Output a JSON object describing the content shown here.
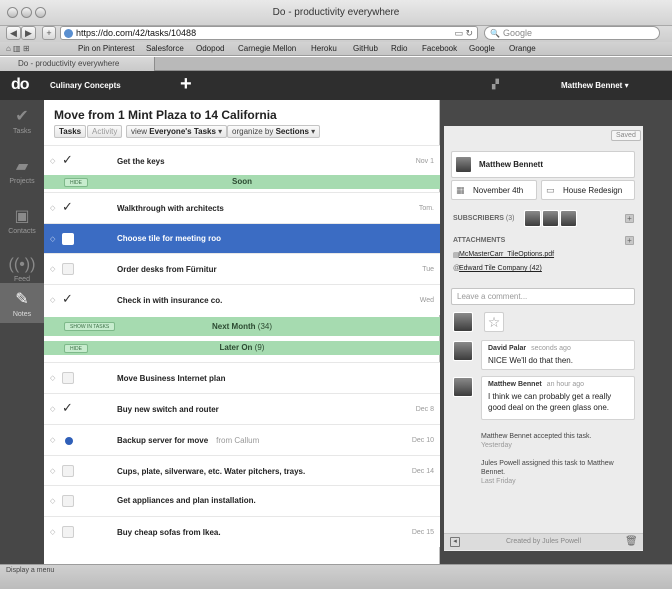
{
  "window": {
    "title": "Do - productivity everywhere"
  },
  "browser": {
    "url": "https://do.com/42/tasks/10488",
    "search_placeholder": "Google",
    "tab_title": "Do - productivity everywhere",
    "bookmarks": [
      "Pin on Pinterest",
      "Salesforce",
      "Odopod",
      "Carnegie Mellon",
      "Heroku",
      "GitHub",
      "Rdio",
      "Facebook",
      "Google",
      "Orange"
    ],
    "status": "Display a menu"
  },
  "app": {
    "logo": "do",
    "workspace": "Culinary Concepts",
    "user": "Matthew Bennet"
  },
  "nav": [
    {
      "label": "Tasks",
      "icon": "check-icon"
    },
    {
      "label": "Projects",
      "icon": "folder-icon"
    },
    {
      "label": "Contacts",
      "icon": "contact-card-icon"
    },
    {
      "label": "Feed",
      "icon": "broadcast-icon"
    },
    {
      "label": "Notes",
      "icon": "pencil-icon"
    }
  ],
  "project": {
    "title": "Move from 1 Mint Plaza to 14 California",
    "tabs": [
      "Tasks",
      "Activity"
    ],
    "view_prefix": "view",
    "view_value": "Everyone's Tasks",
    "organize_prefix": "organize by",
    "organize_value": "Sections"
  },
  "tasks_top": [
    {
      "text": "Get the keys",
      "date": "Nov 1",
      "checked": true
    },
    {
      "text": "Walkthrough with architects",
      "date": "Tom.",
      "checked": true
    },
    {
      "text": "Choose tile for meeting roo",
      "date": "",
      "checked": false,
      "selected": true
    },
    {
      "text": "Order desks from Fürnitur",
      "date": "Tue",
      "checked": false
    },
    {
      "text": "Check in with insurance co.",
      "date": "Wed",
      "checked": true
    }
  ],
  "sections": {
    "soon": {
      "tag": "HIDE",
      "title": "Soon"
    },
    "next_month": {
      "tag": "SHOW IN TASKS",
      "title": "Next Month",
      "count": "(34)"
    },
    "later_on": {
      "tag": "HIDE",
      "title": "Later On",
      "count": "(9)"
    }
  },
  "tasks_later": [
    {
      "text": "Move Business Internet plan",
      "sub": "",
      "date": "",
      "state": "open"
    },
    {
      "text": "Buy new switch and router",
      "sub": "",
      "date": "Dec 8",
      "state": "checked"
    },
    {
      "text": "Backup server for move",
      "sub": "from Callum",
      "date": "Dec 10",
      "state": "dot"
    },
    {
      "text": "Cups, plate, silverware, etc. Water pitchers, trays.",
      "sub": "",
      "date": "Dec 14",
      "state": "open"
    },
    {
      "text": "Get appliances and plan installation.",
      "sub": "",
      "date": "",
      "state": "open"
    },
    {
      "text": "Buy cheap sofas from Ikea.",
      "sub": "",
      "date": "Dec 15",
      "state": "open"
    }
  ],
  "detail": {
    "saved": "Saved",
    "assignee": "Matthew Bennett",
    "due": "November 4th",
    "project": "House Redesign",
    "subscribers_label": "SUBSCRIBERS",
    "subscribers_count": "(3)",
    "attachments_label": "ATTACHMENTS",
    "attachments": [
      "McMasterCarr_TileOptions.pdf",
      "Edward Tile Company (42)"
    ],
    "comment_placeholder": "Leave a comment...",
    "comments": [
      {
        "author": "David Palar",
        "time": "seconds ago",
        "text": "NICE We'll do that then."
      },
      {
        "author": "Matthew Bennet",
        "time": "an hour ago",
        "text": "I think we can probably get a really good deal on the green glass one."
      }
    ],
    "activity": [
      {
        "text": "Matthew Bennet accepted this task.",
        "time": "Yesterday"
      },
      {
        "text": "Jules Powell assigned this task to Matthew Bennet.",
        "time": "Last Friday"
      }
    ],
    "created_by": "Created by Jules Powell"
  },
  "colors": {
    "accent_select": "#3b6cc3",
    "section_green": "#a6dbb0",
    "app_bar": "#2e2e2e",
    "sidebar": "#474747"
  }
}
